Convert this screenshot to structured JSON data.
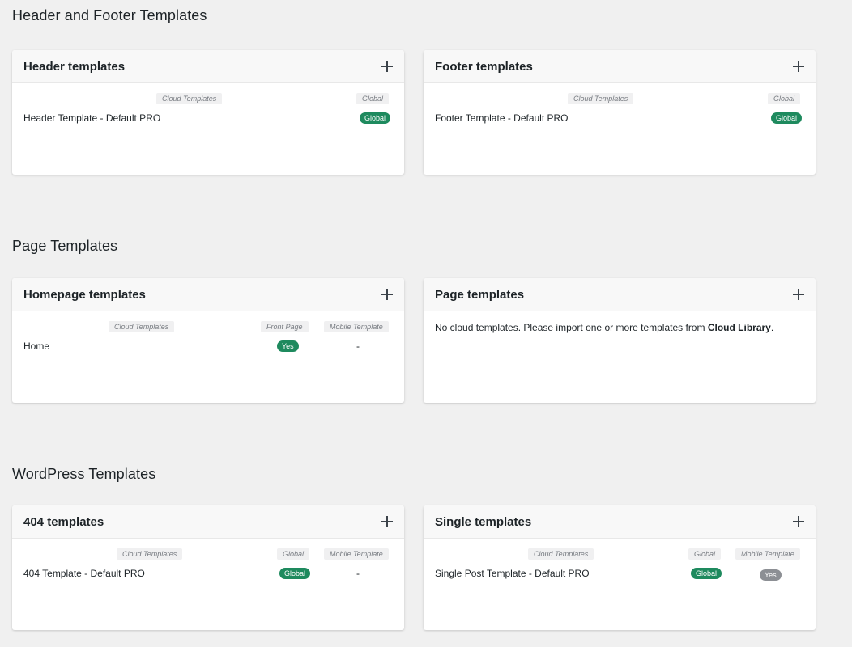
{
  "sections": [
    {
      "title": "Header and Footer Templates",
      "cards": [
        {
          "title": "Header templates",
          "columns": [
            "Cloud Templates",
            "Global"
          ],
          "rows": [
            {
              "name": "Header Template - Default PRO",
              "global": "Global"
            }
          ]
        },
        {
          "title": "Footer templates",
          "columns": [
            "Cloud Templates",
            "Global"
          ],
          "rows": [
            {
              "name": "Footer Template - Default PRO",
              "global": "Global"
            }
          ]
        }
      ]
    },
    {
      "title": "Page Templates",
      "cards": [
        {
          "title": "Homepage templates",
          "columns": [
            "Cloud Templates",
            "Front Page",
            "Mobile Template"
          ],
          "rows": [
            {
              "name": "Home",
              "front_page": "Yes",
              "mobile": "-"
            }
          ]
        },
        {
          "title": "Page templates",
          "empty_message": "No cloud templates. Please import one or more templates from",
          "empty_link": "Cloud Library",
          "empty_end": "."
        }
      ]
    },
    {
      "title": "WordPress Templates",
      "cards": [
        {
          "title": "404 templates",
          "columns": [
            "Cloud Templates",
            "Global",
            "Mobile Template"
          ],
          "rows": [
            {
              "name": "404 Template - Default PRO",
              "global": "Global",
              "mobile": "-"
            }
          ]
        },
        {
          "title": "Single templates",
          "columns": [
            "Cloud Templates",
            "Global",
            "Mobile Template"
          ],
          "rows": [
            {
              "name": "Single Post Template - Default PRO",
              "global": "Global",
              "mobile": "Yes"
            }
          ]
        }
      ]
    }
  ],
  "colors": {
    "badge_green": "#1e8a5e",
    "badge_gray": "#8c8f94",
    "background": "#f0f0f0"
  },
  "icons": {
    "add": "plus-icon"
  }
}
